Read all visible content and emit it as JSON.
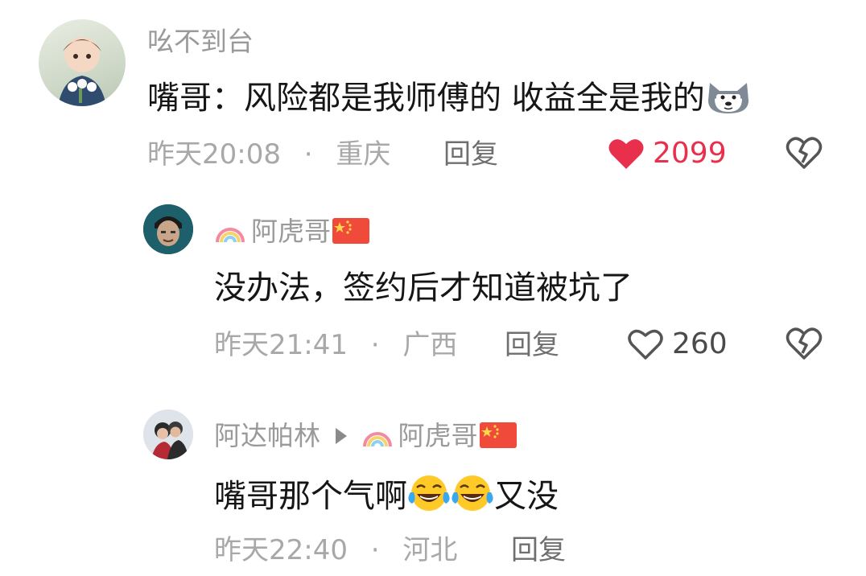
{
  "comments": [
    {
      "author": "吆不到台",
      "text": "嘴哥：风险都是我师傅的 收益全是我的",
      "time": "昨天20:08",
      "separator": "·",
      "location": "重庆",
      "reply_label": "回复",
      "likes": "2099",
      "liked": true,
      "emoji": "doge-icon",
      "colors": {
        "like": "#e8304d"
      }
    },
    {
      "author": "阿虎哥",
      "text": "没办法，签约后才知道被坑了",
      "time": "昨天21:41",
      "separator": "·",
      "location": "广西",
      "reply_label": "回复",
      "likes": "260",
      "liked": false
    },
    {
      "author": "阿达帕林",
      "reply_to": "阿虎哥",
      "text": "嘴哥那个气啊",
      "text_suffix": "又没",
      "time": "昨天22:40",
      "separator": "·",
      "location": "河北",
      "reply_label": "回复",
      "emoji": "laugh-cry-icon"
    }
  ]
}
